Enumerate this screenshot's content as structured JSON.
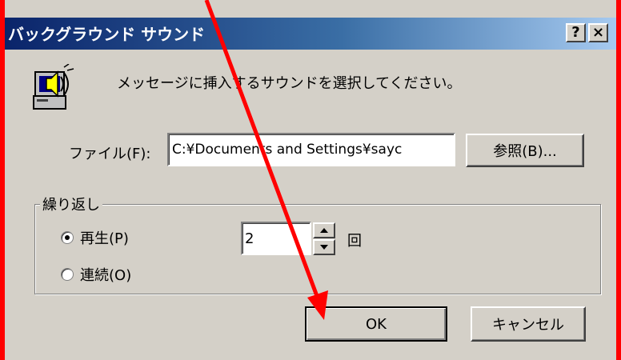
{
  "titlebar": {
    "title": "バックグラウンド サウンド",
    "help_label": "?",
    "close_label": "×"
  },
  "message": "メッセージに挿入するサウンドを選択してください。",
  "file": {
    "label": "ファイル(F):",
    "value": "C:¥Documents and Settings¥sayc",
    "browse_label": "参照(B)..."
  },
  "repeat": {
    "group_title": "繰り返し",
    "play_label": "再生(P)",
    "loop_label": "連続(O)",
    "selected": "play",
    "count": "2",
    "times_label": "回"
  },
  "buttons": {
    "ok_label": "OK",
    "cancel_label": "キャンセル"
  },
  "icons": {
    "sound": "sound-speaker-computer-icon",
    "help": "help-icon",
    "close": "close-icon",
    "spin_up": "chevron-up-icon",
    "spin_down": "chevron-down-icon"
  },
  "colors": {
    "annotation_frame": "#ff0000",
    "annotation_arrow": "#ff0000",
    "dialog_bg": "#d4d0c8",
    "titlebar_start": "#0a246a",
    "titlebar_end": "#a6caf0"
  }
}
